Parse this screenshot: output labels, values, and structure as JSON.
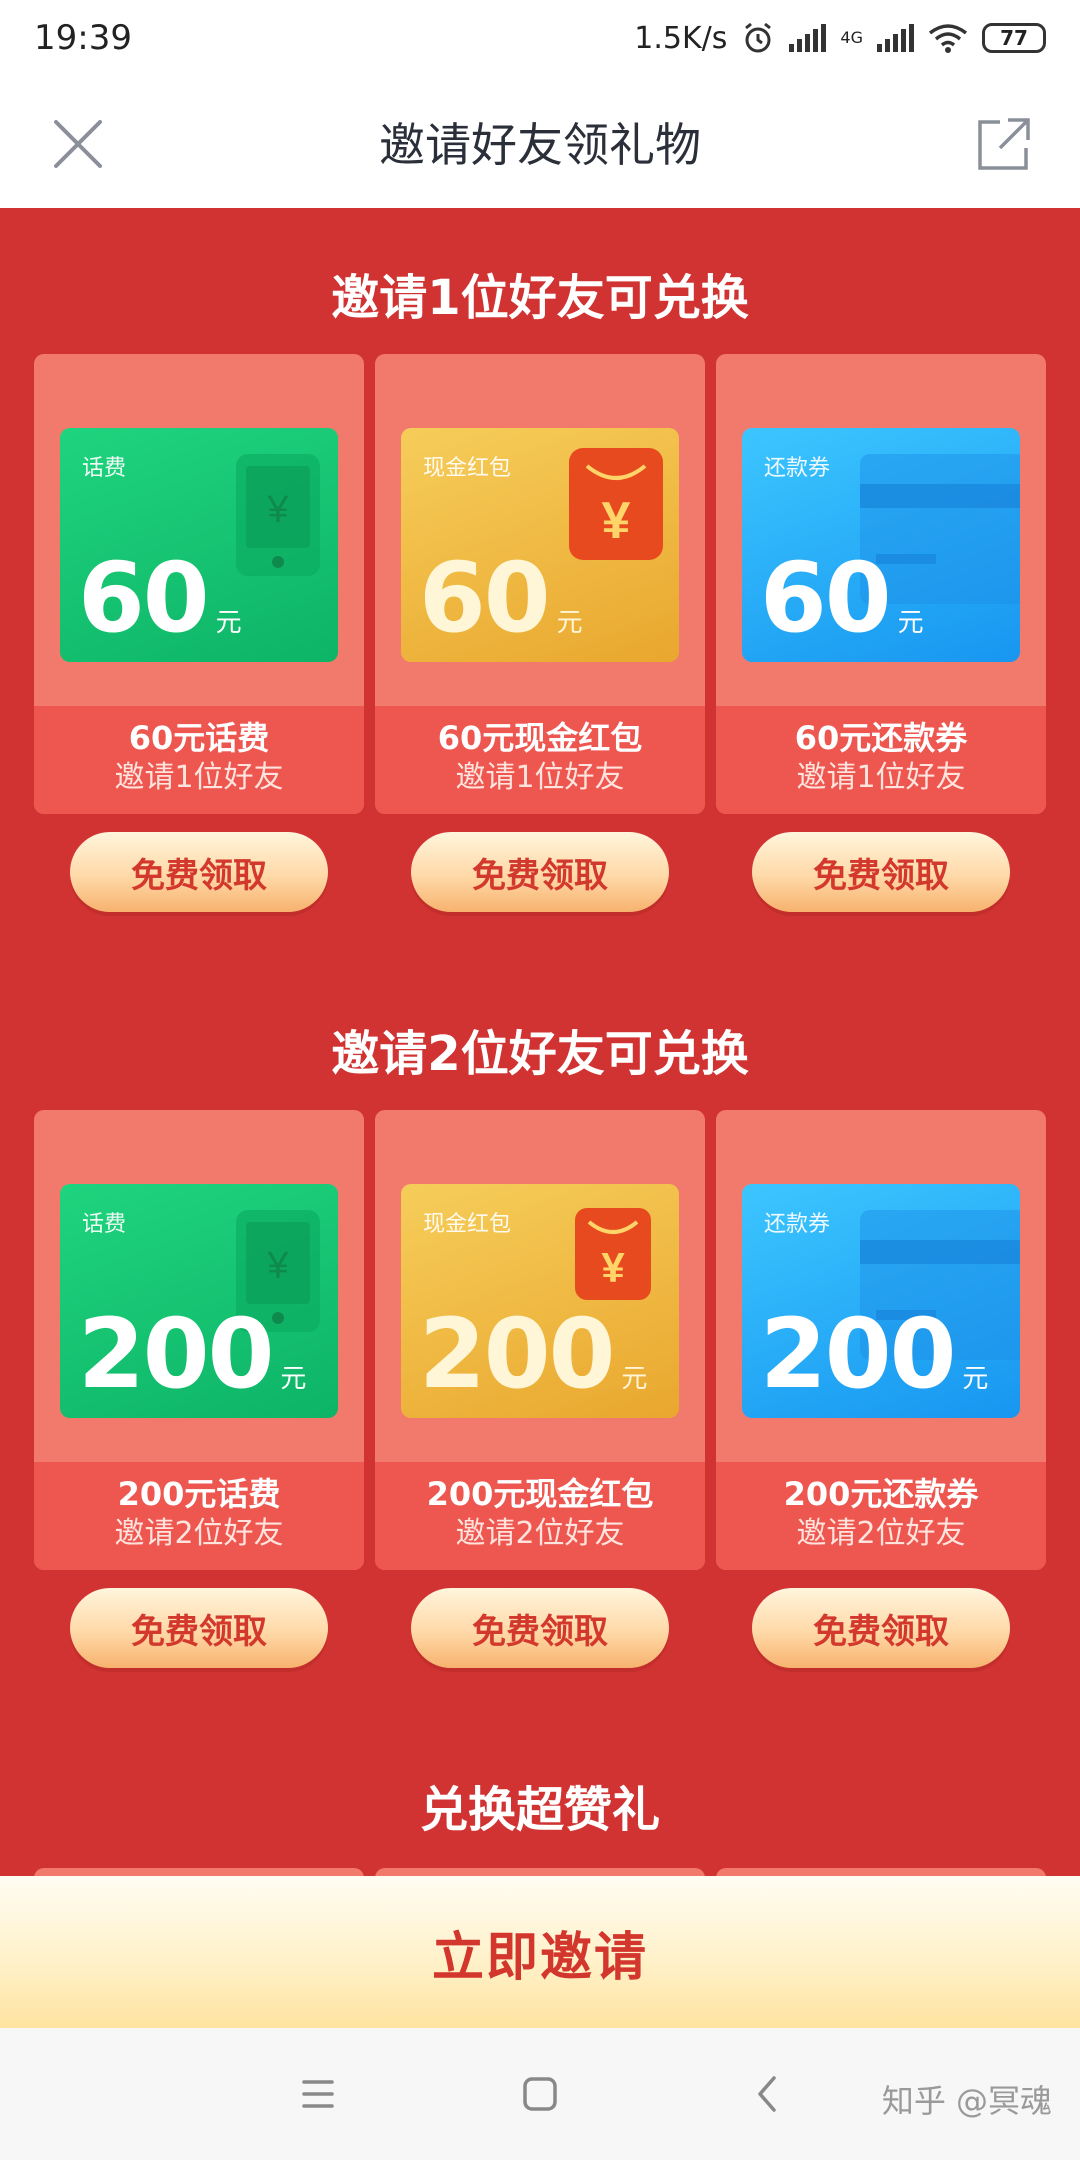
{
  "status_bar": {
    "time": "19:39",
    "net_speed": "1.5K/s",
    "network": "4G",
    "battery": "77",
    "icons": [
      "alarm-icon",
      "signal-icon",
      "signal-4g-icon",
      "wifi-icon",
      "battery-icon"
    ]
  },
  "header": {
    "title": "邀请好友领礼物",
    "close_icon": "close-icon",
    "share_icon": "share-icon"
  },
  "sections": [
    {
      "title": "邀请1位好友可兑换",
      "cards": [
        {
          "tag": "话费",
          "amount": "60",
          "unit": "元",
          "name": "60元话费",
          "subtitle": "邀请1位好友",
          "button": "免费领取",
          "color": "#13c774"
        },
        {
          "tag": "现金红包",
          "amount": "60",
          "unit": "元",
          "name": "60元现金红包",
          "subtitle": "邀请1位好友",
          "button": "免费领取",
          "color": "#efb63f"
        },
        {
          "tag": "还款券",
          "amount": "60",
          "unit": "元",
          "name": "60元还款券",
          "subtitle": "邀请1位好友",
          "button": "免费领取",
          "color": "#27adf8"
        }
      ]
    },
    {
      "title": "邀请2位好友可兑换",
      "cards": [
        {
          "tag": "话费",
          "amount": "200",
          "unit": "元",
          "name": "200元话费",
          "subtitle": "邀请2位好友",
          "button": "免费领取",
          "color": "#13c774"
        },
        {
          "tag": "现金红包",
          "amount": "200",
          "unit": "元",
          "name": "200元现金红包",
          "subtitle": "邀请2位好友",
          "button": "免费领取",
          "color": "#efb63f"
        },
        {
          "tag": "还款券",
          "amount": "200",
          "unit": "元",
          "name": "200元还款券",
          "subtitle": "邀请2位好友",
          "button": "免费领取",
          "color": "#27adf8"
        }
      ]
    },
    {
      "title": "兑换超赞礼",
      "cards": []
    }
  ],
  "invite_button": "立即邀请",
  "nav_bar": {
    "icons": [
      "menu-icon",
      "home-icon",
      "back-icon"
    ],
    "watermark": "知乎 @冥魂"
  },
  "colors": {
    "background": "#d13333",
    "card": "#f27a6c",
    "card_info": "#ee5650",
    "button_text": "#d3382d"
  }
}
